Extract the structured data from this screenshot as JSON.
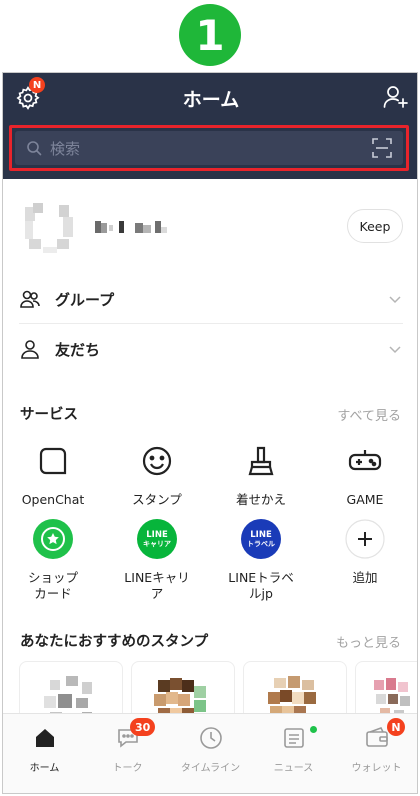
{
  "step": {
    "number": "1"
  },
  "header": {
    "title": "ホーム",
    "settings_badge": "N",
    "search_placeholder": "検索"
  },
  "profile": {
    "keep_label": "Keep"
  },
  "lists": {
    "groups_label": "グループ",
    "friends_label": "友だち"
  },
  "services": {
    "title": "サービス",
    "see_all": "すべて見る",
    "items": [
      {
        "label": "OpenChat",
        "icon": "chat-bubble-icon"
      },
      {
        "label": "スタンプ",
        "icon": "smiley-icon"
      },
      {
        "label": "着せかえ",
        "icon": "brush-icon"
      },
      {
        "label": "GAME",
        "icon": "gamepad-icon"
      },
      {
        "label_line1": "ショップ",
        "label_line2": "カード",
        "icon": "shop-card-icon",
        "color": "#1fc14a"
      },
      {
        "label_line1": "LINEキャリ",
        "label_line2": "ア",
        "icon": "line-carrier-icon",
        "badge_top": "LINE",
        "badge_bottom": "キャリア",
        "color": "#07b53b"
      },
      {
        "label_line1": "LINEトラベ",
        "label_line2": "ルjp",
        "icon": "line-travel-icon",
        "badge_top": "LINE",
        "badge_bottom": "トラベル",
        "color": "#1a3bb8"
      },
      {
        "label": "追加",
        "icon": "plus-icon"
      }
    ]
  },
  "stamps": {
    "title": "あなたにおすすめのスタンプ",
    "see_more": "もっと見る"
  },
  "tabbar": {
    "tabs": [
      {
        "label": "ホーム",
        "icon": "home-icon"
      },
      {
        "label": "トーク",
        "icon": "talk-icon",
        "badge": "30"
      },
      {
        "label": "タイムライン",
        "icon": "clock-icon"
      },
      {
        "label": "ニュース",
        "icon": "news-icon"
      },
      {
        "label": "ウォレット",
        "icon": "wallet-icon",
        "badge": "N"
      }
    ]
  },
  "colors": {
    "header_bg": "#2a3348",
    "accent_green": "#1fb739",
    "badge_red": "#f4411e",
    "highlight_red": "#e8242b"
  }
}
